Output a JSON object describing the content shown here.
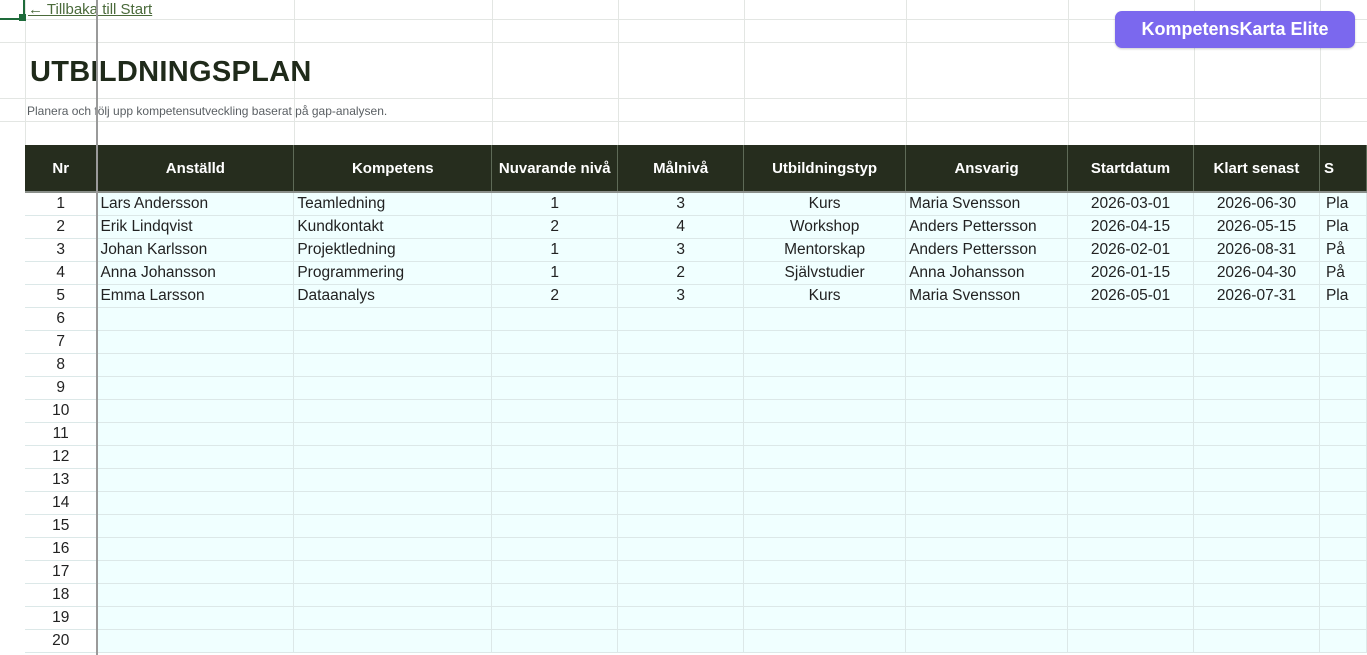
{
  "nav": {
    "back_label": "← Tillbaka till Start"
  },
  "brand": {
    "label": "KompetensKarta Elite",
    "color": "#7b68ee"
  },
  "page": {
    "title": "UTBILDNINGSPLAN",
    "subtitle": "Planera och följ upp kompetensutveckling baserat på gap-analysen."
  },
  "table": {
    "headers": [
      "Nr",
      "Anställd",
      "Kompetens",
      "Nuvarande nivå",
      "Målnivå",
      "Utbildningstyp",
      "Ansvarig",
      "Startdatum",
      "Klart senast",
      "S"
    ],
    "rows": [
      [
        "1",
        "Lars Andersson",
        "Teamledning",
        "1",
        "3",
        "Kurs",
        "Maria Svensson",
        "2026-03-01",
        "2026-06-30",
        "Pla"
      ],
      [
        "2",
        "Erik Lindqvist",
        "Kundkontakt",
        "2",
        "4",
        "Workshop",
        "Anders Pettersson",
        "2026-04-15",
        "2026-05-15",
        "Pla"
      ],
      [
        "3",
        "Johan Karlsson",
        "Projektledning",
        "1",
        "3",
        "Mentorskap",
        "Anders Pettersson",
        "2026-02-01",
        "2026-08-31",
        "På"
      ],
      [
        "4",
        "Anna Johansson",
        "Programmering",
        "1",
        "2",
        "Självstudier",
        "Anna Johansson",
        "2026-01-15",
        "2026-04-30",
        "På"
      ],
      [
        "5",
        "Emma Larsson",
        "Dataanalys",
        "2",
        "3",
        "Kurs",
        "Maria Svensson",
        "2026-05-01",
        "2026-07-31",
        "Pla"
      ],
      [
        "6",
        "",
        "",
        "",
        "",
        "",
        "",
        "",
        "",
        ""
      ],
      [
        "7",
        "",
        "",
        "",
        "",
        "",
        "",
        "",
        "",
        ""
      ],
      [
        "8",
        "",
        "",
        "",
        "",
        "",
        "",
        "",
        "",
        ""
      ],
      [
        "9",
        "",
        "",
        "",
        "",
        "",
        "",
        "",
        "",
        ""
      ],
      [
        "10",
        "",
        "",
        "",
        "",
        "",
        "",
        "",
        "",
        ""
      ],
      [
        "11",
        "",
        "",
        "",
        "",
        "",
        "",
        "",
        "",
        ""
      ],
      [
        "12",
        "",
        "",
        "",
        "",
        "",
        "",
        "",
        "",
        ""
      ],
      [
        "13",
        "",
        "",
        "",
        "",
        "",
        "",
        "",
        "",
        ""
      ],
      [
        "14",
        "",
        "",
        "",
        "",
        "",
        "",
        "",
        "",
        ""
      ],
      [
        "15",
        "",
        "",
        "",
        "",
        "",
        "",
        "",
        "",
        ""
      ],
      [
        "16",
        "",
        "",
        "",
        "",
        "",
        "",
        "",
        "",
        ""
      ],
      [
        "17",
        "",
        "",
        "",
        "",
        "",
        "",
        "",
        "",
        ""
      ],
      [
        "18",
        "",
        "",
        "",
        "",
        "",
        "",
        "",
        "",
        ""
      ],
      [
        "19",
        "",
        "",
        "",
        "",
        "",
        "",
        "",
        "",
        ""
      ],
      [
        "20",
        "",
        "",
        "",
        "",
        "",
        "",
        "",
        "",
        ""
      ]
    ]
  }
}
